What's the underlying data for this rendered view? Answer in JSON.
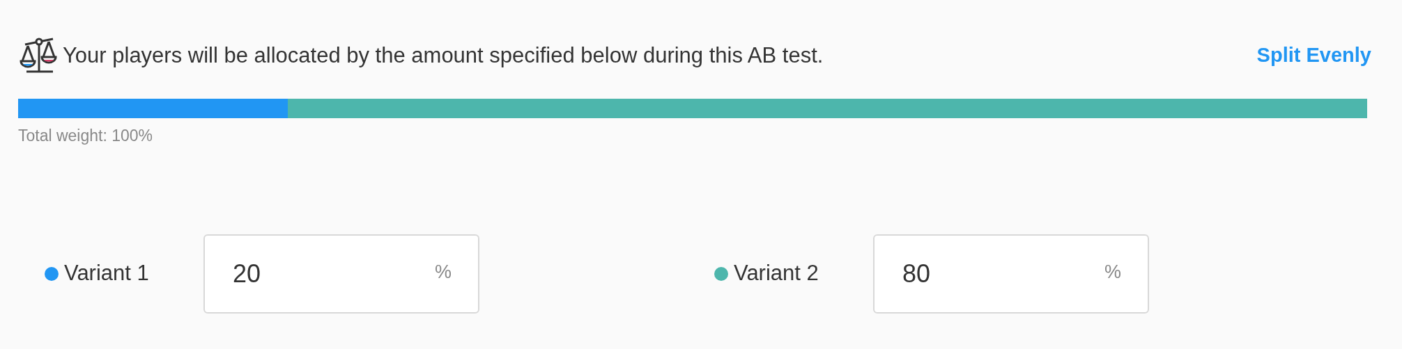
{
  "header": {
    "message": "Your players will be allocated by the amount specified below during this AB test.",
    "action": "Split Evenly"
  },
  "total": "Total weight: 100%",
  "variants": [
    {
      "label": "Variant 1",
      "value": "20",
      "unit": "%",
      "color": "#2196f3",
      "level": 0.2
    },
    {
      "label": "Variant 2",
      "value": "80",
      "unit": "%",
      "color": "#4db6ac",
      "level": 0.8
    }
  ]
}
